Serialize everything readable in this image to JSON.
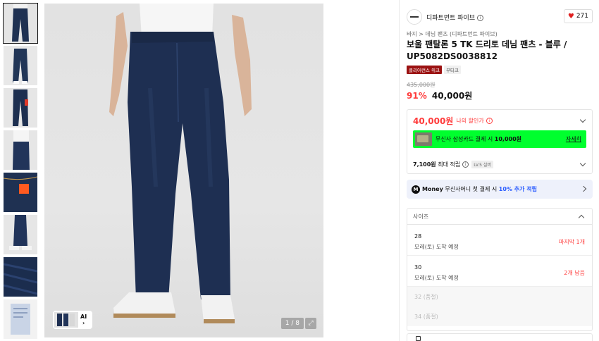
{
  "gallery": {
    "thumbnail_count": 8,
    "pager": "1 / 8",
    "ai_badge": "AI",
    "expand_icon": "expand-icon"
  },
  "brand": {
    "name": "디파트먼트 파이브",
    "likes": "271"
  },
  "product": {
    "breadcrumb": "바지 > 데님 팬츠 (디파트먼트 파이브)",
    "title": "보울 팬탈론 5 TK 드리토 데님 팬츠 - 블루 / UP5082DS0038812",
    "tags": [
      "클리어런스 위크",
      "부티크"
    ],
    "original_price": "435,000원",
    "discount": "91%",
    "sale_price": "40,000원"
  },
  "my_price": {
    "price": "40,000원",
    "label": "나의 할인가",
    "card_banner": {
      "text_prefix": "무신사 삼성카드 결제 시",
      "amount": "10,000원",
      "link": "자세히"
    },
    "points": {
      "value": "7,100원",
      "label": "최대 적립",
      "level": "LV.5 실버"
    }
  },
  "money": {
    "icon_letter": "M",
    "brand": "Money",
    "text": "무신사머니 첫 결제 시",
    "highlight": "10% 추가 적립"
  },
  "size": {
    "header": "사이즈",
    "options": [
      {
        "name": "28",
        "sub": "모레(토) 도착 예정",
        "stock": "마지막 1개"
      },
      {
        "name": "30",
        "sub": "모레(토) 도착 예정",
        "stock": "2개 남음"
      },
      {
        "name": "32 (품절)"
      },
      {
        "name": "34 (품절)"
      }
    ]
  },
  "colors": {
    "accent_red": "#ff3b3b",
    "card_green": "#00ff2e",
    "money_blue": "#2b5cff",
    "tag_red": "#9b1111"
  }
}
